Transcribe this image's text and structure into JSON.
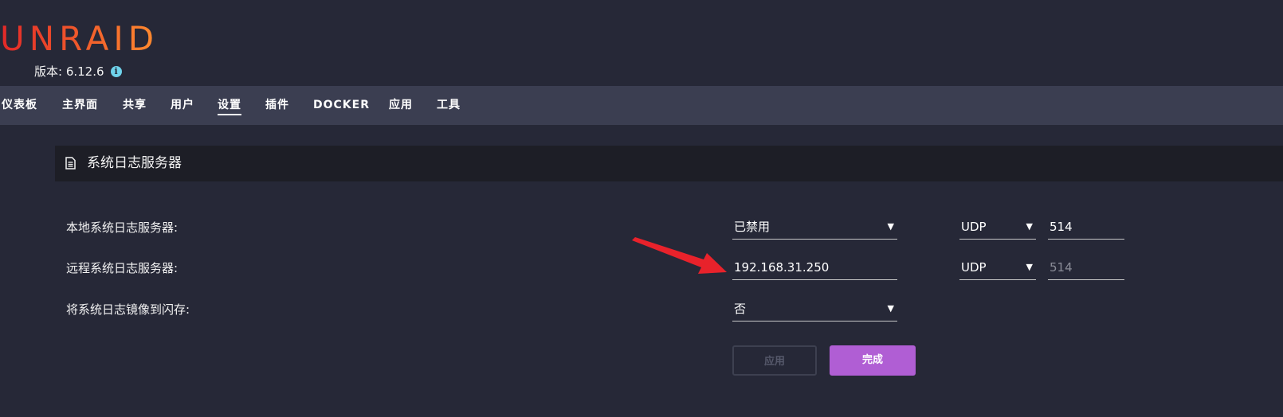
{
  "header": {
    "logo_text": "UNRAID",
    "version_label": "版本: 6.12.6",
    "info_icon": "i"
  },
  "nav": {
    "items": [
      {
        "label": "仪表板"
      },
      {
        "label": "主界面"
      },
      {
        "label": "共享"
      },
      {
        "label": "用户"
      },
      {
        "label": "设置",
        "active": true
      },
      {
        "label": "插件"
      },
      {
        "label": "DOCKER"
      },
      {
        "label": "应用"
      },
      {
        "label": "工具"
      }
    ]
  },
  "panel": {
    "title": "系统日志服务器",
    "icon": "document-icon"
  },
  "rows": {
    "local": {
      "label": "本地系统日志服务器:",
      "value": "已禁用",
      "protocol": "UDP",
      "port": "514"
    },
    "remote": {
      "label": "远程系统日志服务器:",
      "value": "192.168.31.250",
      "protocol": "UDP",
      "port_placeholder": "514"
    },
    "mirror": {
      "label": "将系统日志镜像到闪存:",
      "value": "否"
    }
  },
  "buttons": {
    "apply": "应用",
    "done": "完成"
  },
  "colors": {
    "background": "#262837",
    "navbar": "#3b3e51",
    "panel_title_bg": "#1d1e26",
    "done_button": "#b05ed4",
    "annotation_arrow": "#e8222b",
    "logo_gradient_start": "#e22828",
    "logo_gradient_end": "#ff8c2f"
  }
}
